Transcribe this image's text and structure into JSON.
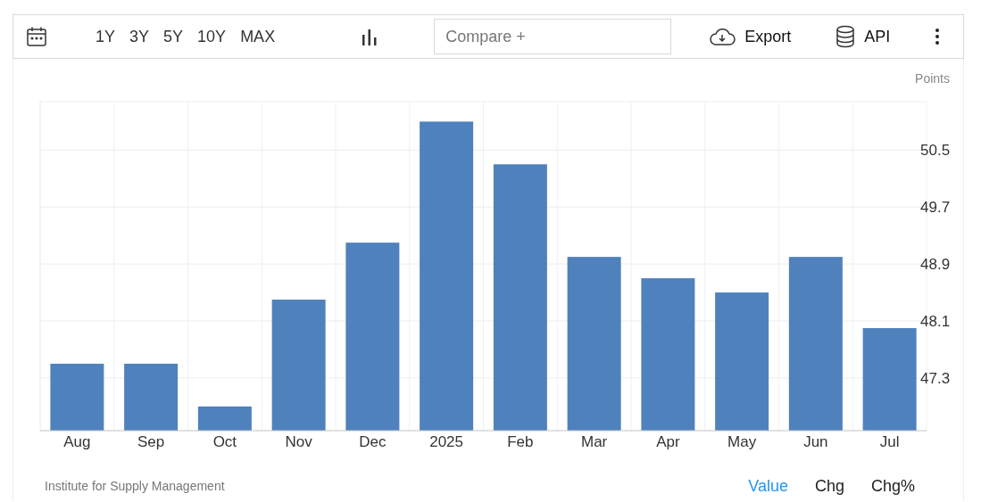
{
  "toolbar": {
    "ranges": [
      {
        "label": "1Y"
      },
      {
        "label": "3Y"
      },
      {
        "label": "5Y"
      },
      {
        "label": "10Y"
      },
      {
        "label": "MAX"
      }
    ],
    "compare": {
      "placeholder": "Compare +"
    },
    "export": "Export",
    "api": "API"
  },
  "chart": {
    "chart_data": {
      "type": "bar",
      "ylabel": "Points",
      "categories": [
        "Aug",
        "Sep",
        "Oct",
        "Nov",
        "Dec",
        "2025",
        "Feb",
        "Mar",
        "Apr",
        "May",
        "Jun",
        "Jul"
      ],
      "grid": true,
      "series": [
        {
          "color": "#4f81bd",
          "values": [
            47.5,
            47.5,
            46.9,
            48.4,
            49.2,
            50.9,
            50.3,
            49.0,
            48.7,
            48.5,
            49.0,
            48.0
          ]
        }
      ],
      "ylim": [
        46.56,
        51.18
      ],
      "yticks": [
        47.3,
        48.1,
        48.9,
        49.7,
        50.5
      ]
    }
  },
  "footer": {
    "source": "Institute for Supply Management",
    "modes": [
      {
        "label": "Value",
        "selected": true
      },
      {
        "label": "Chg",
        "selected": false
      },
      {
        "label": "Chg%",
        "selected": false
      }
    ]
  }
}
